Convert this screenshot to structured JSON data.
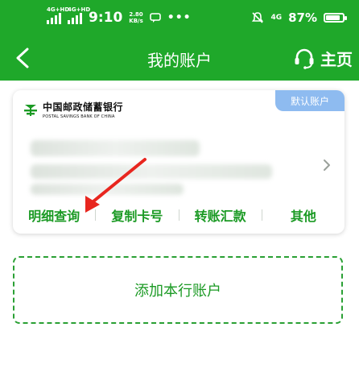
{
  "status_bar": {
    "sim1_tag": "4G+HD",
    "sim2_tag": "4G+HD",
    "time": "9:10",
    "net_speed_value": "2.80",
    "net_speed_unit": "KB/s",
    "more": "•••",
    "network_type": "4G",
    "battery_percent": "87%",
    "battery_level": 0.87
  },
  "header": {
    "title": "我的账户",
    "home_label": "主页"
  },
  "card": {
    "bank_name_cn": "中国邮政储蓄银行",
    "bank_name_en": "POSTAL SAVINGS BANK OF CHINA",
    "default_badge": "默认账户",
    "actions": [
      {
        "label": "明细查询"
      },
      {
        "label": "复制卡号"
      },
      {
        "label": "转账汇款"
      },
      {
        "label": "其他"
      }
    ]
  },
  "add_account": {
    "label": "添加本行账户"
  },
  "colors": {
    "brand_green": "#1fa82a",
    "action_green": "#1b9a24",
    "badge_blue": "#8ebbf0",
    "annotation_red": "#e8261f"
  }
}
